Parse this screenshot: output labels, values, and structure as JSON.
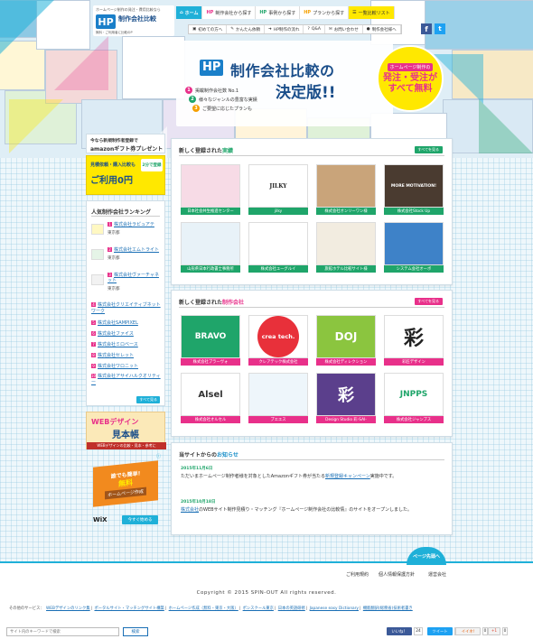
{
  "colors": {
    "accent": "#1fb0d8",
    "pink": "#e8308a",
    "green": "#1fa56a",
    "navy": "#1a4e8a",
    "yellow": "#ffe800"
  },
  "logo": {
    "tagline": "ホームページ制作の発注・費用比較なら",
    "mark": "HP",
    "name": "制作会社比較",
    "sub": "無料・ご利用者に比較のP"
  },
  "nav": {
    "home": "ホーム",
    "search_by_name": "制作会社から探す",
    "search_by_case": "事例から探す",
    "search_by_price": "プランから探す",
    "list": "一覧比較リスト"
  },
  "subnav": [
    "初めての方へ",
    "かんたん依頼",
    "HP制作の流れ",
    "Q&A",
    "お問い合わせ",
    "制作会社様へ"
  ],
  "hero": {
    "mark": "HP",
    "title1": "制作会社比較の",
    "title2": "決定版!!",
    "points": [
      {
        "num": "1",
        "text": "掲載制作会社数 No.1"
      },
      {
        "num": "2",
        "text": "様々なジャンルの豊富な実績"
      },
      {
        "num": "3",
        "text": "ご要望に応じたプランも"
      }
    ],
    "badge_cap": "ホームページ制作の",
    "badge_line1": "発注・受注が",
    "badge_line2": "すべて無料"
  },
  "sidebar": {
    "promo_top": "今なら新規制作者登録で",
    "promo_amazon": "amazonギフト券プレゼント",
    "promo_free_line1": "見積依頼・購入比較も",
    "promo_free_line2": "ご利用0円",
    "promo_free_tag": "2分で登録",
    "ranking_title": "人気制作会社ランキング",
    "ranking": [
      {
        "num": "1",
        "name": "株式会社ラピュアテ",
        "loc": "東京都"
      },
      {
        "num": "2",
        "name": "株式会社エムトライト",
        "loc": "東京都"
      },
      {
        "num": "3",
        "name": "株式会社ヴァーチャネット",
        "loc": "東京都"
      }
    ],
    "ranking_more": [
      {
        "num": "4",
        "name": "株式会社クリエイティブネットワーク"
      },
      {
        "num": "5",
        "name": "株式会社SAMPIXEL"
      },
      {
        "num": "6",
        "name": "株式会社ファイス"
      },
      {
        "num": "7",
        "name": "株式会社ミロベース"
      },
      {
        "num": "8",
        "name": "株式会社セレット"
      },
      {
        "num": "9",
        "name": "株式会社ワロニット"
      },
      {
        "num": "10",
        "name": "株式会社アサイハルクオリティー"
      }
    ],
    "ranking_more_btn": "すべて見る",
    "web_banner_line1": "WEBデザイン",
    "web_banner_line2": "見本帳",
    "web_banner_sub": "WEBデザインの比較・見本・参考に",
    "wix_line1": "誰でも簡単!",
    "wix_line2": "無料",
    "wix_line3": "ホームページ作成",
    "wix_brand": "WiX",
    "wix_btn": "今すぐ始める"
  },
  "panels": {
    "works": {
      "title_pre": "新しく登録された",
      "title_hl": "実績",
      "more": "すべてを見る",
      "cards": [
        {
          "img": "",
          "cap": "日本社会共生推進センター",
          "bg": "#f7dbe6"
        },
        {
          "img": "JILKY",
          "cap": "jilky",
          "bg": "#ffffff"
        },
        {
          "img": "",
          "cap": "株式会社オンリーワン様",
          "bg": "#c9a47a"
        },
        {
          "img": "MORE MOTIVATION!",
          "cap": "株式会社Stock Up",
          "bg": "#4a3b30"
        },
        {
          "img": "",
          "cap": "山形県日本行政書士事務所",
          "bg": "#e8f2f8"
        },
        {
          "img": "",
          "cap": "株式会社ユーグルイ",
          "bg": "#ffffff"
        },
        {
          "img": "",
          "cap": "旅館ホテル比較サイト様",
          "bg": "#f2ece0"
        },
        {
          "img": "",
          "cap": "システム会社オーボ",
          "bg": "#3e82c8"
        }
      ]
    },
    "companies": {
      "title_pre": "新しく登録された",
      "title_hl": "制作会社",
      "more": "すべてを見る",
      "cards": [
        {
          "img": "BRAVO",
          "cap": "株式会社ブラーヴォ",
          "bg": "#1fa56a",
          "fg": "#ffffff"
        },
        {
          "img": "crea tech.",
          "cap": "クレアテック株式会社",
          "bg": "#e8303a",
          "fg": "#ffffff"
        },
        {
          "img": "DOJ",
          "cap": "株式会社ディレクション",
          "bg": "#8bc53f",
          "fg": "#ffffff"
        },
        {
          "img": "彩",
          "cap": "彩匠デザイン",
          "bg": "#ffffff",
          "fg": "#222222"
        },
        {
          "img": "Alsel",
          "cap": "株式会社オルセル",
          "bg": "#ffffff",
          "fg": "#333333"
        },
        {
          "img": "",
          "cap": "プエエス",
          "bg": "#eef6fb",
          "fg": "#333333"
        },
        {
          "img": "彩",
          "cap": "Design Studio 彩-SAI-",
          "bg": "#5b3f8c",
          "fg": "#ffffff"
        },
        {
          "img": "JNPPS",
          "cap": "株式会社ジャンプス",
          "bg": "#ffffff",
          "fg": "#1fa56a"
        }
      ]
    },
    "news": {
      "title_pre": "当サイトからの",
      "title_hl": "お知らせ",
      "items": [
        {
          "date": "2015年11月6日",
          "text_pre": "ただいまホームページ制作者様を対象としたAmazonギフト券が当たる",
          "link": "新規登録キャンペーン",
          "text_post": "実施中です。"
        },
        {
          "date": "2015年10月18日",
          "text_pre": "",
          "link": "株式会社",
          "text_post": "のWEBサイト制作見積り・マッチング『ホームページ制作会社の比較情』のサイトをオープンしました。"
        }
      ]
    }
  },
  "footer": {
    "pagetop": "ページ先頭へ",
    "links": [
      "ご利用規約",
      "個人情報保護方針",
      "運営会社"
    ],
    "copyright": "Copyright © 2015 SPIN-OUT All rights reserved.",
    "services_label": "その他のサービス：",
    "services": [
      "WEBデザインのリンク集",
      "ポータルサイト・マッチングサイト構築",
      "ホームページ作成（無料・東京・大阪）",
      "ポンスクール東京",
      "日本の英語研修",
      "Japanese easy Dictionary",
      "機能翻訳(総務省)技術者書き"
    ],
    "search_placeholder": "サイト内のキーワードで検索",
    "search_btn": "検索",
    "social": [
      {
        "label": "いいね！",
        "count": "24",
        "bg": "#3b5998",
        "fg": "#ffffff"
      },
      {
        "label": "ツイート",
        "count": "1",
        "bg": "#1da1f2",
        "fg": "#ffffff"
      },
      {
        "label": "イイネ!",
        "count": "0",
        "bg": "#f2f2f2",
        "fg": "#e85a00"
      },
      {
        "label": "+1",
        "count": "0",
        "bg": "#f2f2f2",
        "fg": "#dd4b39"
      }
    ]
  }
}
